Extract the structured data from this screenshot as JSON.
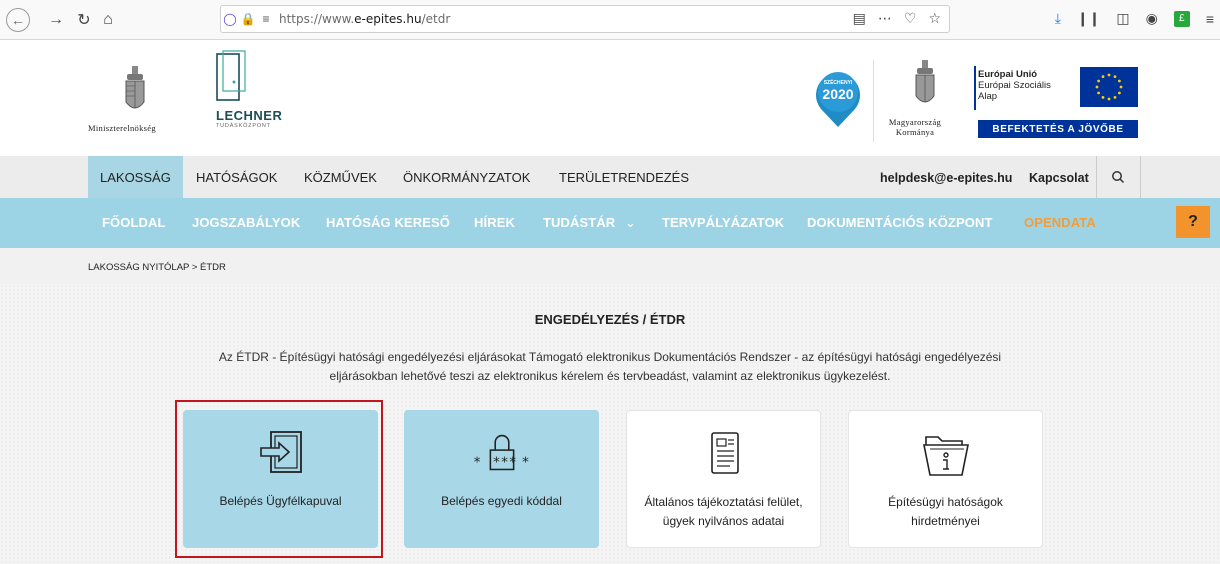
{
  "browser": {
    "url_prefix": "https://www.",
    "url_domain": "e-epites.hu",
    "url_path": "/etdr"
  },
  "header": {
    "ministry_text": "Miniszterelnökség",
    "lechner_name": "LECHNER",
    "lechner_sub": "TUDÁSKÖZPONT",
    "szechenyi_label": "SZÉCHENYI",
    "szechenyi_year": "2020",
    "gov_line1": "Magyarország",
    "gov_line2": "Kormánya",
    "eu_line1": "Európai Unió",
    "eu_line2": "Európai Szociális",
    "eu_line3": "Alap",
    "eu_banner": "BEFEKTETÉS A JÖVŐBE"
  },
  "main_nav": {
    "items": [
      "LAKOSSÁG",
      "HATÓSÁGOK",
      "KÖZMŰVEK",
      "ÖNKORMÁNYZATOK",
      "TERÜLETRENDEZÉS"
    ],
    "helpdesk": "helpdesk@e-epites.hu",
    "contact": "Kapcsolat"
  },
  "sub_nav": {
    "items": [
      "FŐOLDAL",
      "JOGSZABÁLYOK",
      "HATÓSÁG KERESŐ",
      "HÍREK",
      "TUDÁSTÁR",
      "TERVPÁLYÁZATOK",
      "DOKUMENTÁCIÓS KÖZPONT",
      "OPENDATA"
    ],
    "tudastar_caret": "⌄",
    "help": "?"
  },
  "breadcrumb": "LAKOSSÁG NYITÓLAP > ÉTDR",
  "content": {
    "title": "ENGEDÉLYEZÉS / ÉTDR",
    "desc_line1": "Az ÉTDR - Építésügyi hatósági engedélyezési eljárásokat Támogató elektronikus Dokumentációs Rendszer - az építésügyi hatósági engedélyezési",
    "desc_line2": "eljárásokban lehetővé teszi az elektronikus kérelem és tervbeadást, valamint az elektronikus ügykezelést.",
    "tiles": [
      {
        "label": "Belépés Ügyfélkapuval"
      },
      {
        "label": "Belépés egyedi kóddal"
      },
      {
        "label_line1": "Általános tájékoztatási felület,",
        "label_line2": "ügyek nyilvános adatai"
      },
      {
        "label_line1": "Építésügyi hatóságok",
        "label_line2": "hirdetményei"
      }
    ]
  },
  "colors": {
    "sub_nav_bg": "#9dd4e5",
    "opendata": "#f19d3c",
    "highlight": "#c0171e",
    "eu_blue": "#003399"
  }
}
